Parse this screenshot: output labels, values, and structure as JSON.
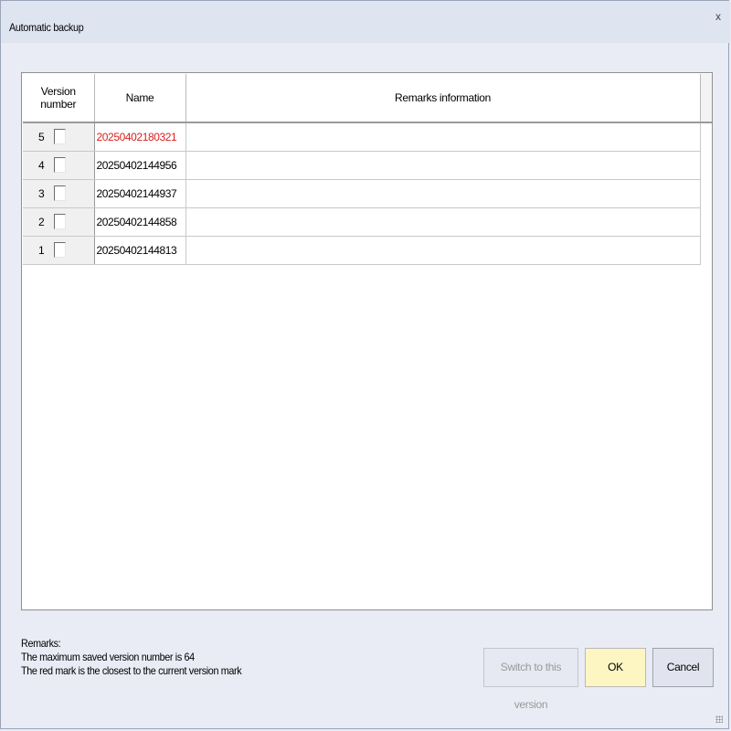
{
  "window": {
    "title": "Automatic backup",
    "close_glyph": "x"
  },
  "table": {
    "headers": {
      "version": "Version number",
      "name": "Name",
      "remarks": "Remarks information"
    },
    "rows": [
      {
        "version": "5",
        "checked": false,
        "name": "20250402180321",
        "remarks": "",
        "highlight": true
      },
      {
        "version": "4",
        "checked": false,
        "name": "20250402144956",
        "remarks": "",
        "highlight": false
      },
      {
        "version": "3",
        "checked": false,
        "name": "20250402144937",
        "remarks": "",
        "highlight": false
      },
      {
        "version": "2",
        "checked": false,
        "name": "20250402144858",
        "remarks": "",
        "highlight": false
      },
      {
        "version": "1",
        "checked": false,
        "name": "20250402144813",
        "remarks": "",
        "highlight": false
      }
    ]
  },
  "remarks": {
    "label": "Remarks:",
    "line1": "The maximum saved version number is 64",
    "line2": "The red mark is the closest to the current version mark"
  },
  "buttons": {
    "switch": "Switch to this version",
    "ok": "OK",
    "cancel": "Cancel"
  },
  "colors": {
    "highlight": "#d8201f",
    "ok_bg": "#fdf6c3"
  }
}
